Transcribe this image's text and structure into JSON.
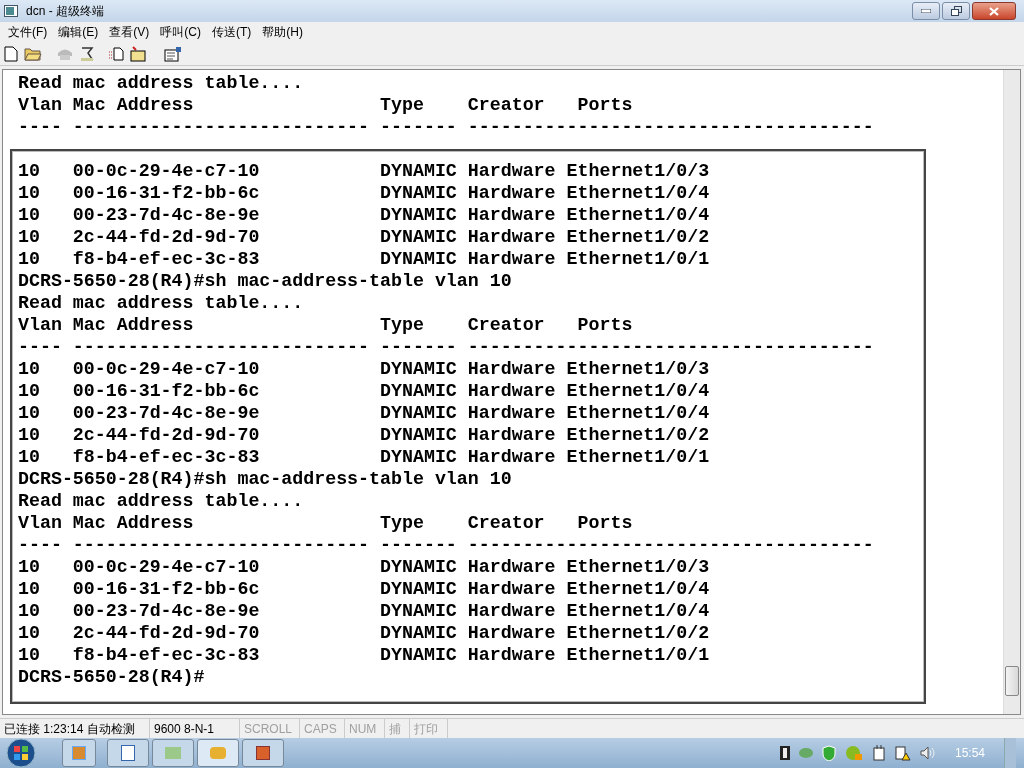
{
  "window": {
    "title": "dcn - 超级终端"
  },
  "menu": [
    "文件(F)",
    "编辑(E)",
    "查看(V)",
    "呼叫(C)",
    "传送(T)",
    "帮助(H)"
  ],
  "terminal": {
    "lines_above": [
      "Read mac address table....",
      "Vlan Mac Address                 Type    Creator   Ports",
      "---- --------------------------- ------- -------------------------------------"
    ],
    "lines_framed": [
      "10   00-0c-29-4e-c7-10           DYNAMIC Hardware Ethernet1/0/3",
      "10   00-16-31-f2-bb-6c           DYNAMIC Hardware Ethernet1/0/4",
      "10   00-23-7d-4c-8e-9e           DYNAMIC Hardware Ethernet1/0/4",
      "10   2c-44-fd-2d-9d-70           DYNAMIC Hardware Ethernet1/0/2",
      "10   f8-b4-ef-ec-3c-83           DYNAMIC Hardware Ethernet1/0/1",
      "DCRS-5650-28(R4)#sh mac-address-table vlan 10",
      "Read mac address table....",
      "Vlan Mac Address                 Type    Creator   Ports",
      "---- --------------------------- ------- -------------------------------------",
      "10   00-0c-29-4e-c7-10           DYNAMIC Hardware Ethernet1/0/3",
      "10   00-16-31-f2-bb-6c           DYNAMIC Hardware Ethernet1/0/4",
      "10   00-23-7d-4c-8e-9e           DYNAMIC Hardware Ethernet1/0/4",
      "10   2c-44-fd-2d-9d-70           DYNAMIC Hardware Ethernet1/0/2",
      "10   f8-b4-ef-ec-3c-83           DYNAMIC Hardware Ethernet1/0/1",
      "DCRS-5650-28(R4)#sh mac-address-table vlan 10",
      "Read mac address table....",
      "Vlan Mac Address                 Type    Creator   Ports",
      "---- --------------------------- ------- -------------------------------------",
      "10   00-0c-29-4e-c7-10           DYNAMIC Hardware Ethernet1/0/3",
      "10   00-16-31-f2-bb-6c           DYNAMIC Hardware Ethernet1/0/4",
      "10   00-23-7d-4c-8e-9e           DYNAMIC Hardware Ethernet1/0/4",
      "10   2c-44-fd-2d-9d-70           DYNAMIC Hardware Ethernet1/0/2",
      "10   f8-b4-ef-ec-3c-83           DYNAMIC Hardware Ethernet1/0/1",
      "DCRS-5650-28(R4)#"
    ]
  },
  "status_bar": [
    {
      "text": "已连接 1:23:14 自动检测",
      "disabled": false
    },
    {
      "text": "9600 8-N-1",
      "disabled": false
    },
    {
      "text": "SCROLL",
      "disabled": true
    },
    {
      "text": "CAPS",
      "disabled": true
    },
    {
      "text": "NUM",
      "disabled": true
    },
    {
      "text": "捕",
      "disabled": true
    },
    {
      "text": "打印",
      "disabled": true
    }
  ],
  "taskbar": {
    "clock": "15:54"
  }
}
